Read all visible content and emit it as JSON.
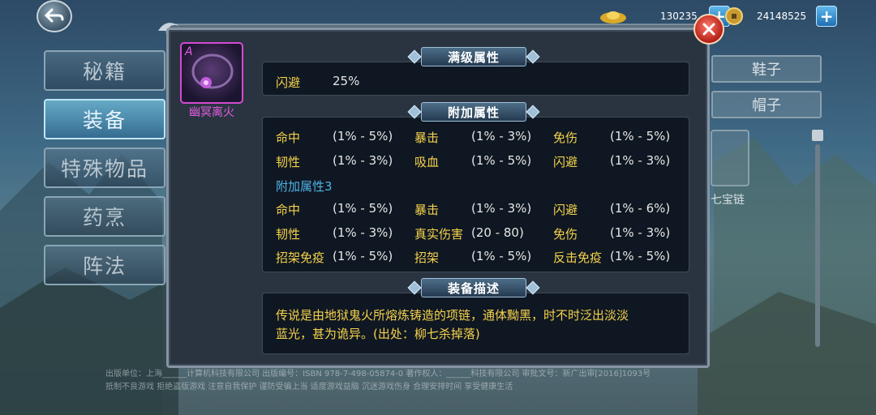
{
  "currency": {
    "ingot_amount": "130235",
    "coin_amount": "24148525"
  },
  "left_tabs": [
    {
      "label": "秘籍"
    },
    {
      "label": "装备"
    },
    {
      "label": "特殊物品"
    },
    {
      "label": "药烹"
    },
    {
      "label": "阵法"
    }
  ],
  "right_panel": {
    "tabs": [
      {
        "label": "鞋子"
      },
      {
        "label": "帽子"
      }
    ],
    "item_label": "七宝链"
  },
  "item": {
    "grade": "A",
    "name": "幽冥离火"
  },
  "full_level": {
    "header": "满级属性",
    "name": "闪避",
    "value": "25%"
  },
  "extra": {
    "header": "附加属性",
    "group1": [
      [
        {
          "n": "命中",
          "v": "(1% - 5%)"
        },
        {
          "n": "暴击",
          "v": "(1% - 3%)"
        },
        {
          "n": "免伤",
          "v": "(1% - 5%)"
        }
      ],
      [
        {
          "n": "韧性",
          "v": "(1% - 3%)"
        },
        {
          "n": "吸血",
          "v": "(1% - 5%)"
        },
        {
          "n": "闪避",
          "v": "(1% - 3%)"
        }
      ]
    ],
    "group2_title": "附加属性3",
    "group2": [
      [
        {
          "n": "命中",
          "v": "(1% - 5%)"
        },
        {
          "n": "暴击",
          "v": "(1% - 3%)"
        },
        {
          "n": "闪避",
          "v": "(1% - 6%)"
        }
      ],
      [
        {
          "n": "韧性",
          "v": "(1% - 3%)"
        },
        {
          "n": "真实伤害",
          "v": "(20 - 80)"
        },
        {
          "n": "免伤",
          "v": "(1% - 3%)"
        }
      ],
      [
        {
          "n": "招架免疫",
          "v": "(1% - 5%)"
        },
        {
          "n": "招架",
          "v": "(1% - 5%)"
        },
        {
          "n": "反击免疫",
          "v": "(1% - 5%)"
        }
      ]
    ]
  },
  "description": {
    "header": "装备描述",
    "line1": "传说是由地狱鬼火所熔炼铸造的项链，通体黝黑，时不时泛出淡淡",
    "line2": "蓝光，甚为诡异。(出处：柳七杀掉落)"
  },
  "footer": {
    "line1": "出版单位：上海______计算机科技有限公司    出版编号：ISBN 978-7-498-05874-0    著作权人：______科技有限公司    审批文号：新广出审[2016]1093号",
    "line2": "抵制不良游戏  拒绝盗版游戏  注意自我保护  谨防受骗上当  适度游戏益脑  沉迷游戏伤身  合理安排时间  享受健康生活"
  },
  "colors": {
    "attr_name": "#f5d34c",
    "attr_value": "#e6e6e6",
    "group_title": "#4fb4e8",
    "item_name": "#e25de0"
  }
}
